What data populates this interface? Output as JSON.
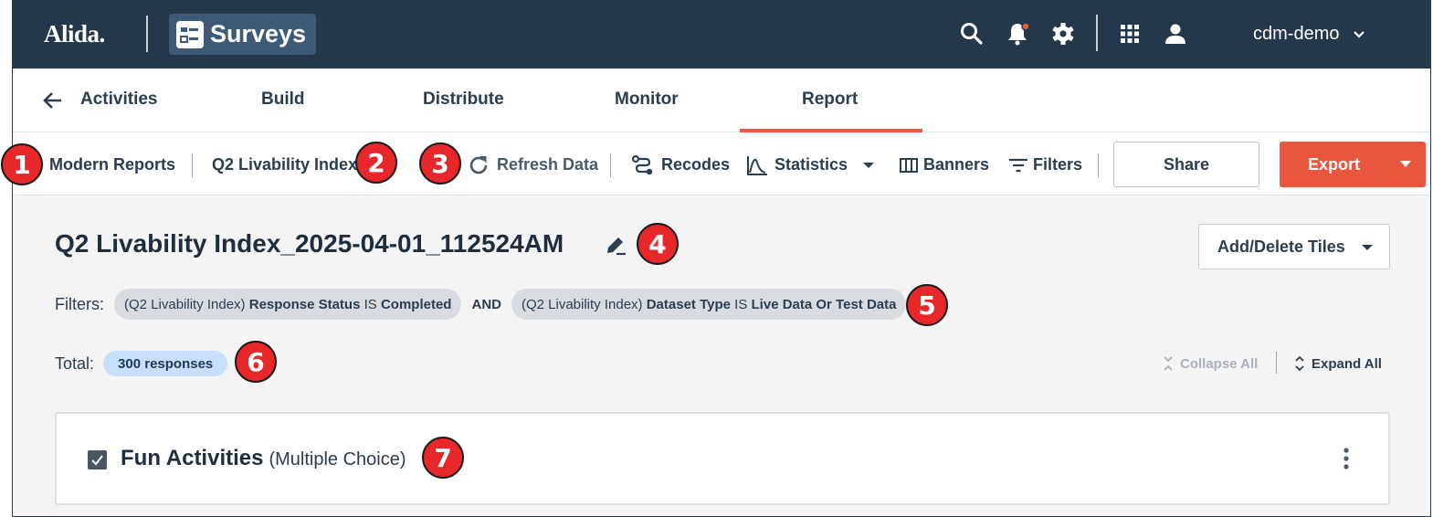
{
  "brand": {
    "logo": "Alida.",
    "app_name": "Surveys"
  },
  "header": {
    "user": "cdm-demo",
    "icons": [
      "search-icon",
      "bell-icon",
      "gear-icon",
      "apps-grid-icon",
      "person-icon"
    ]
  },
  "nav": {
    "back_label": "Activities",
    "tabs": [
      "Build",
      "Distribute",
      "Monitor",
      "Report"
    ],
    "active_tab": "Report"
  },
  "toolbar": {
    "section": "Modern Reports",
    "report_name": "Q2 Livability Index",
    "refresh": "Refresh Data",
    "recodes": "Recodes",
    "statistics": "Statistics",
    "banners": "Banners",
    "filters": "Filters",
    "share": "Share",
    "export": "Export"
  },
  "report": {
    "title": "Q2 Livability Index_2025-04-01_112524AM",
    "add_delete_tiles": "Add/Delete Tiles",
    "filters_label": "Filters:",
    "filters": [
      {
        "prefix": "(Q2 Livability Index)",
        "field": "Response Status",
        "op": "IS",
        "value": "Completed"
      },
      {
        "prefix": "(Q2 Livability Index)",
        "field": "Dataset Type",
        "op": "IS",
        "value": "Live Data Or Test Data"
      }
    ],
    "filter_join": "AND",
    "total_label": "Total:",
    "responses": "300 responses",
    "collapse_all": "Collapse All",
    "expand_all": "Expand All"
  },
  "card": {
    "title": "Fun Activities",
    "type": "(Multiple Choice)"
  },
  "callouts": [
    "1",
    "2",
    "3",
    "4",
    "5",
    "6",
    "7"
  ],
  "colors": {
    "header_bg": "#25374a",
    "accent": "#e8573d",
    "callout": "#e8272b",
    "badge": "#c6e0fb"
  }
}
